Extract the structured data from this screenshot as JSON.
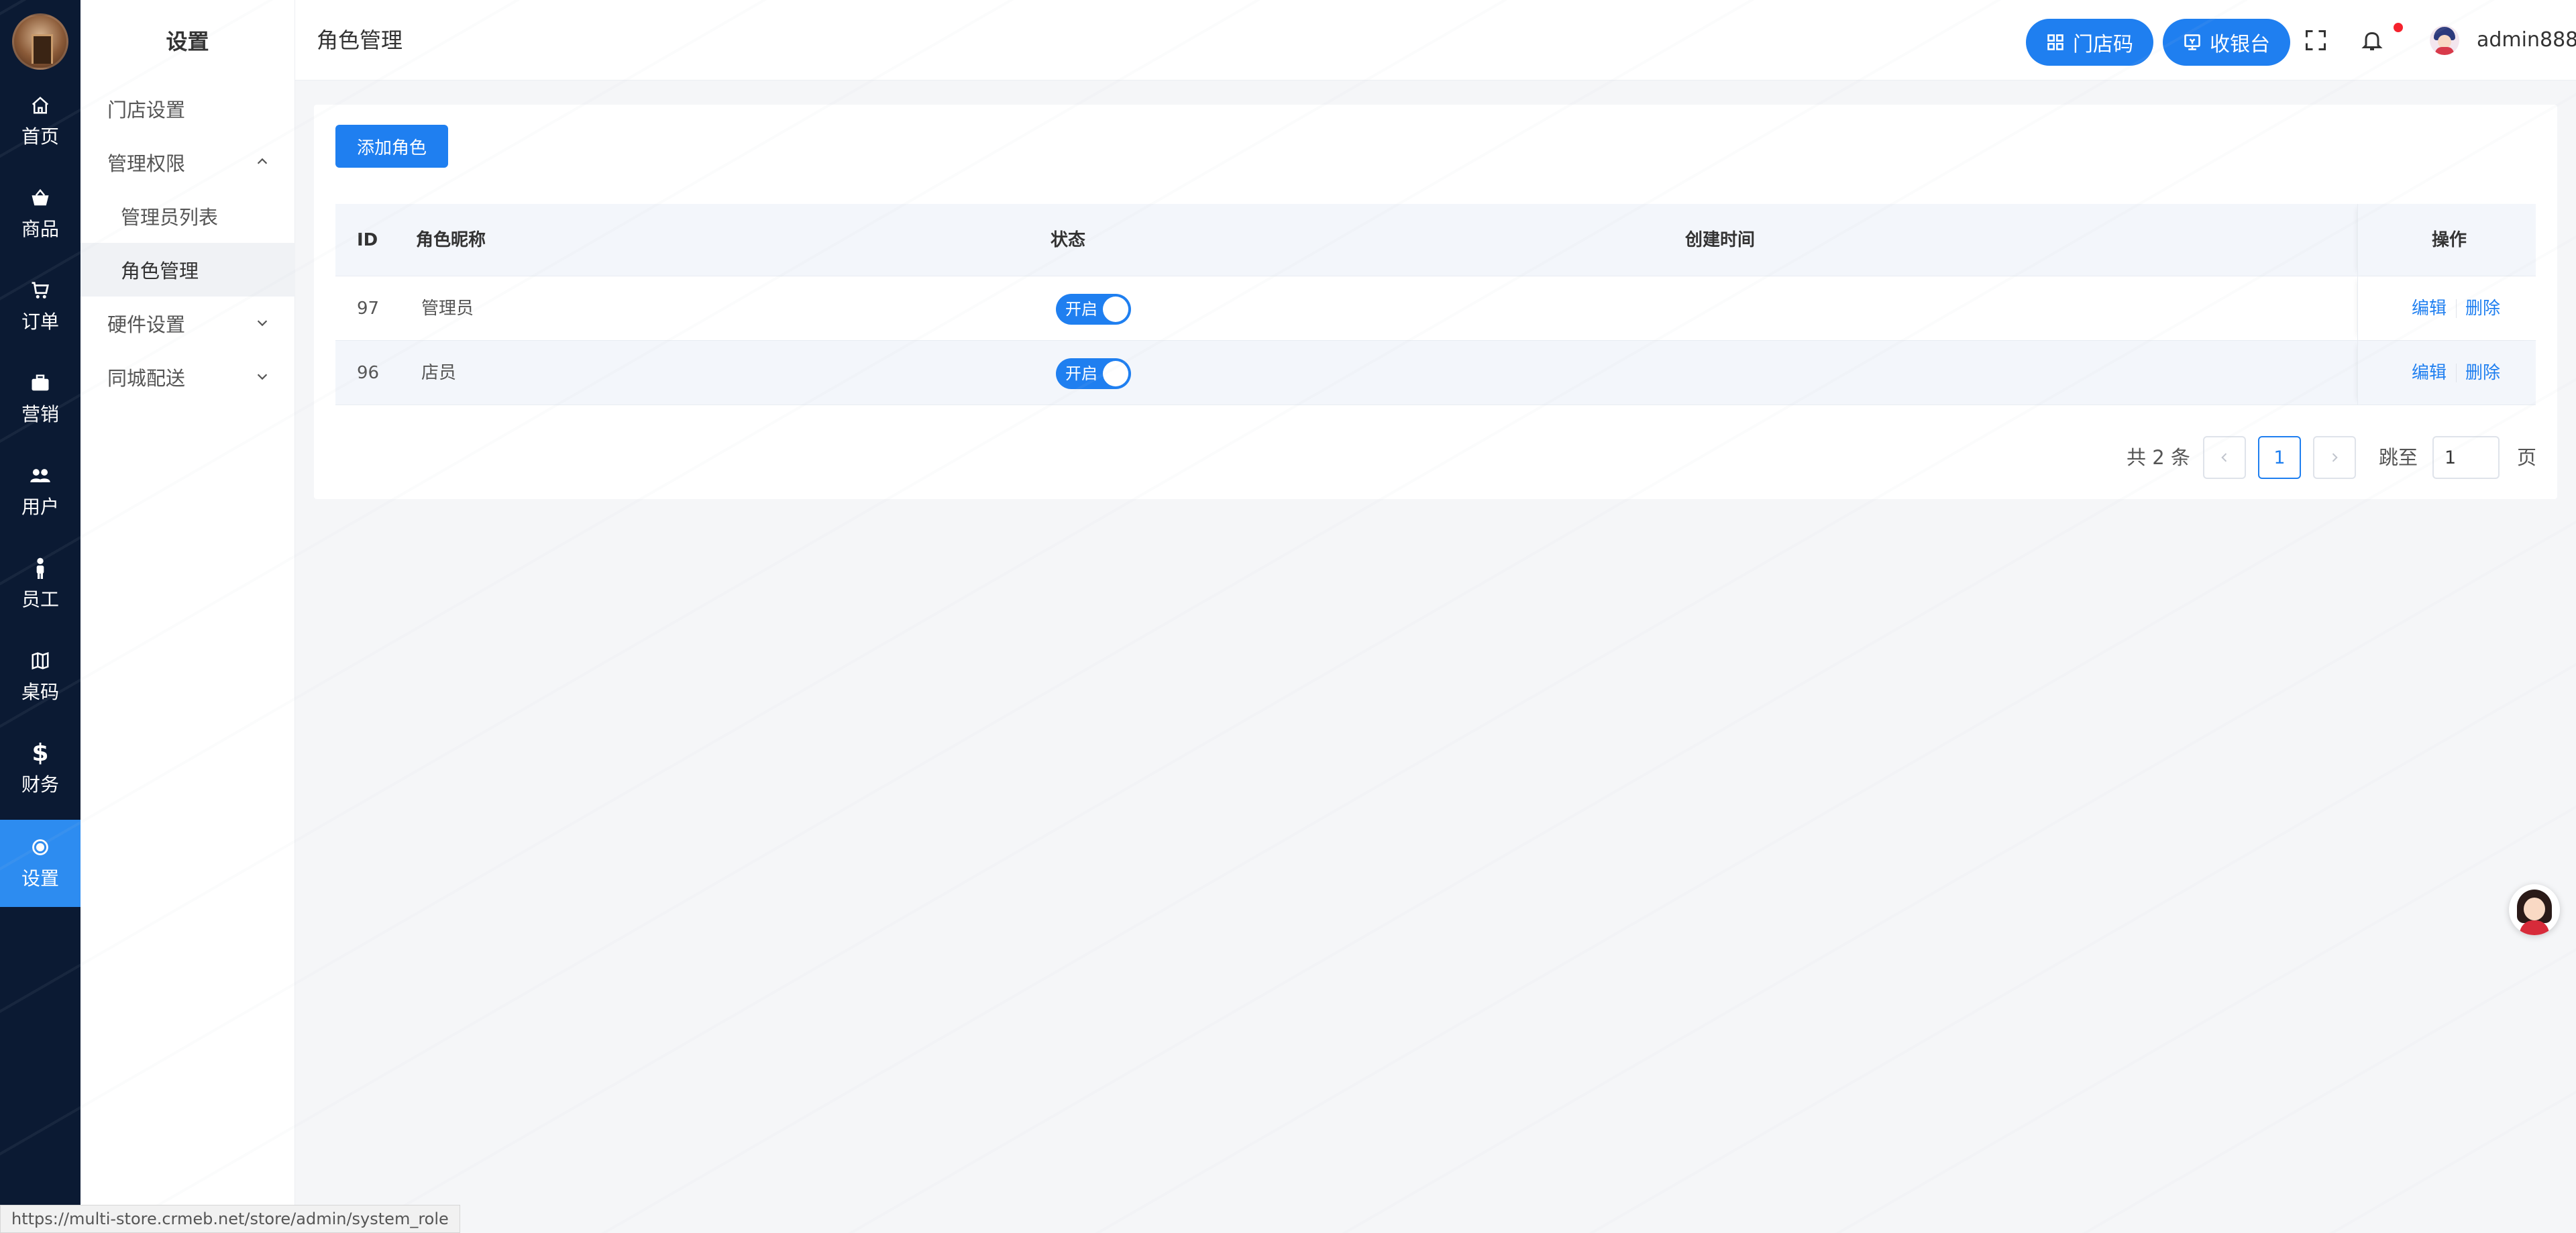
{
  "rail": {
    "items": [
      {
        "label": "首页",
        "icon": "home-icon"
      },
      {
        "label": "商品",
        "icon": "basket-icon"
      },
      {
        "label": "订单",
        "icon": "cart-icon"
      },
      {
        "label": "营销",
        "icon": "briefcase-icon"
      },
      {
        "label": "用户",
        "icon": "users-icon"
      },
      {
        "label": "员工",
        "icon": "person-icon"
      },
      {
        "label": "桌码",
        "icon": "map-icon"
      },
      {
        "label": "财务",
        "icon": "dollar-icon"
      },
      {
        "label": "设置",
        "icon": "settings-icon",
        "active": true
      }
    ]
  },
  "submenu": {
    "title": "设置",
    "items": [
      {
        "label": "门店设置"
      },
      {
        "label": "管理权限",
        "expanded": true
      },
      {
        "label": "管理员列表"
      },
      {
        "label": "角色管理",
        "active": true
      },
      {
        "label": "硬件设置"
      },
      {
        "label": "同城配送"
      }
    ]
  },
  "header": {
    "page_title": "角色管理",
    "store_code_label": "门店码",
    "cashier_label": "收银台",
    "username": "admin888"
  },
  "toolbar": {
    "add_role_label": "添加角色"
  },
  "table": {
    "columns": {
      "id": "ID",
      "name": "角色昵称",
      "status": "状态",
      "created": "创建时间",
      "ops": "操作"
    },
    "rows": [
      {
        "id": "97",
        "name": "管理员",
        "status": "开启",
        "created": "",
        "edit": "编辑",
        "delete": "删除"
      },
      {
        "id": "96",
        "name": "店员",
        "status": "开启",
        "created": "",
        "edit": "编辑",
        "delete": "删除"
      }
    ]
  },
  "pagination": {
    "total_text": "共 2 条",
    "current_page": "1",
    "goto_label": "跳至",
    "goto_value": "1",
    "page_suffix": "页"
  },
  "status_bar": {
    "url": "https://multi-store.crmeb.net/store/admin/system_role"
  },
  "colors": {
    "primary": "#1f7ff0",
    "rail_bg": "#0b1a33",
    "rail_active": "#2d8cf0"
  }
}
